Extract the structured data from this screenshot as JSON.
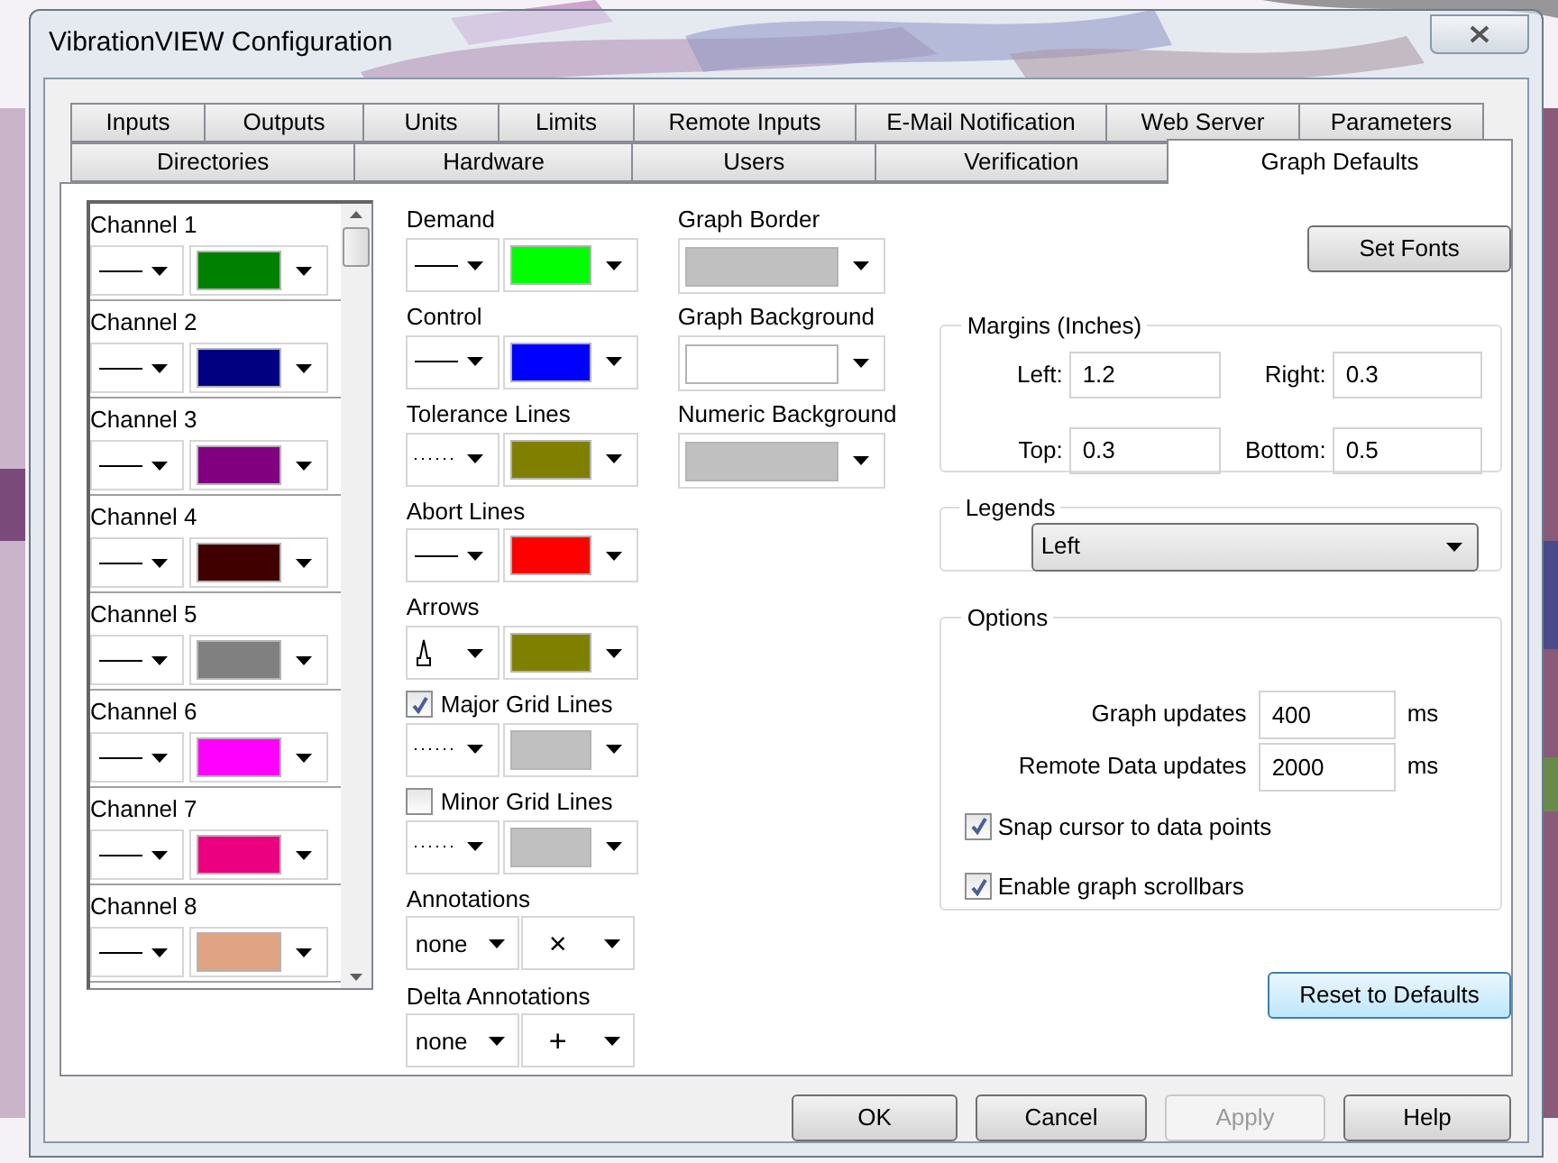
{
  "window": {
    "title": "VibrationVIEW Configuration"
  },
  "tab_rows": [
    {
      "tabs": [
        {
          "label": "Inputs",
          "selected": false
        },
        {
          "label": "Outputs",
          "selected": false
        },
        {
          "label": "Units",
          "selected": false
        },
        {
          "label": "Limits",
          "selected": false
        },
        {
          "label": "Remote Inputs",
          "selected": false
        },
        {
          "label": "E-Mail Notification",
          "selected": false
        },
        {
          "label": "Web Server",
          "selected": false
        },
        {
          "label": "Parameters",
          "selected": false
        }
      ]
    },
    {
      "tabs": [
        {
          "label": "Directories",
          "selected": false
        },
        {
          "label": "Hardware",
          "selected": false
        },
        {
          "label": "Users",
          "selected": false
        },
        {
          "label": "Verification",
          "selected": false
        },
        {
          "label": "Graph Defaults",
          "selected": true
        }
      ]
    }
  ],
  "channels": [
    {
      "label": "Channel 1",
      "line": {
        "kind": "solid"
      },
      "color": "#008000"
    },
    {
      "label": "Channel 2",
      "line": {
        "kind": "solid"
      },
      "color": "#000080"
    },
    {
      "label": "Channel 3",
      "line": {
        "kind": "solid"
      },
      "color": "#800080"
    },
    {
      "label": "Channel 4",
      "line": {
        "kind": "solid"
      },
      "color": "#400000"
    },
    {
      "label": "Channel 5",
      "line": {
        "kind": "solid"
      },
      "color": "#808080"
    },
    {
      "label": "Channel 6",
      "line": {
        "kind": "solid"
      },
      "color": "#ff00ff"
    },
    {
      "label": "Channel 7",
      "line": {
        "kind": "solid"
      },
      "color": "#eb0080"
    },
    {
      "label": "Channel 8",
      "line": {
        "kind": "solid"
      },
      "color": "#e0a384"
    }
  ],
  "styles": [
    {
      "kind": "line-color",
      "label": "Demand",
      "line": {
        "kind": "solid"
      },
      "color": "#00ff00"
    },
    {
      "kind": "line-color",
      "label": "Control",
      "line": {
        "kind": "solid"
      },
      "color": "#0000ff"
    },
    {
      "kind": "line-color",
      "label": "Tolerance Lines",
      "line": {
        "kind": "dashed"
      },
      "color": "#808000"
    },
    {
      "kind": "line-color",
      "label": "Abort Lines",
      "line": {
        "kind": "solid"
      },
      "color": "#ff0000"
    },
    {
      "kind": "line-color",
      "label": "Arrows",
      "line": {
        "kind": "arrow"
      },
      "color": "#808000"
    },
    {
      "kind": "check-line-color",
      "label": "Major Grid Lines",
      "checked": true,
      "line": {
        "kind": "dashed"
      },
      "color": "#c0c0c0"
    },
    {
      "kind": "check-line-color",
      "label": "Minor Grid Lines",
      "checked": false,
      "line": {
        "kind": "dashed"
      },
      "color": "#c0c0c0"
    },
    {
      "kind": "annotation",
      "label": "Annotations",
      "value": "none",
      "marker": "×"
    },
    {
      "kind": "annotation",
      "label": "Delta Annotations",
      "value": "none",
      "marker": "+"
    }
  ],
  "backgrounds": [
    {
      "label": "Graph Border",
      "color": "#c0c0c0"
    },
    {
      "label": "Graph Background",
      "color": "#ffffff"
    },
    {
      "label": "Numeric Background",
      "color": "#c0c0c0"
    }
  ],
  "set_fonts_button": "Set Fonts",
  "margins": {
    "title": "Margins (Inches)",
    "fields": [
      {
        "label": "Left:",
        "value": "1.2"
      },
      {
        "label": "Right:",
        "value": "0.3"
      },
      {
        "label": "Top:",
        "value": "0.3"
      },
      {
        "label": "Bottom:",
        "value": "0.5"
      }
    ]
  },
  "legends": {
    "title": "Legends",
    "value": "Left"
  },
  "options": {
    "title": "Options",
    "rates": [
      {
        "label": "Graph updates",
        "value": "400",
        "unit": "ms"
      },
      {
        "label": "Remote Data updates",
        "value": "2000",
        "unit": "ms"
      }
    ],
    "checkboxes": [
      {
        "label": "Snap cursor to data points",
        "checked": true
      },
      {
        "label": "Enable graph scrollbars",
        "checked": true
      }
    ]
  },
  "reset_button": "Reset to Defaults",
  "buttons": [
    {
      "label": "OK",
      "disabled": false
    },
    {
      "label": "Cancel",
      "disabled": false
    },
    {
      "label": "Apply",
      "disabled": true
    },
    {
      "label": "Help",
      "disabled": false
    }
  ]
}
